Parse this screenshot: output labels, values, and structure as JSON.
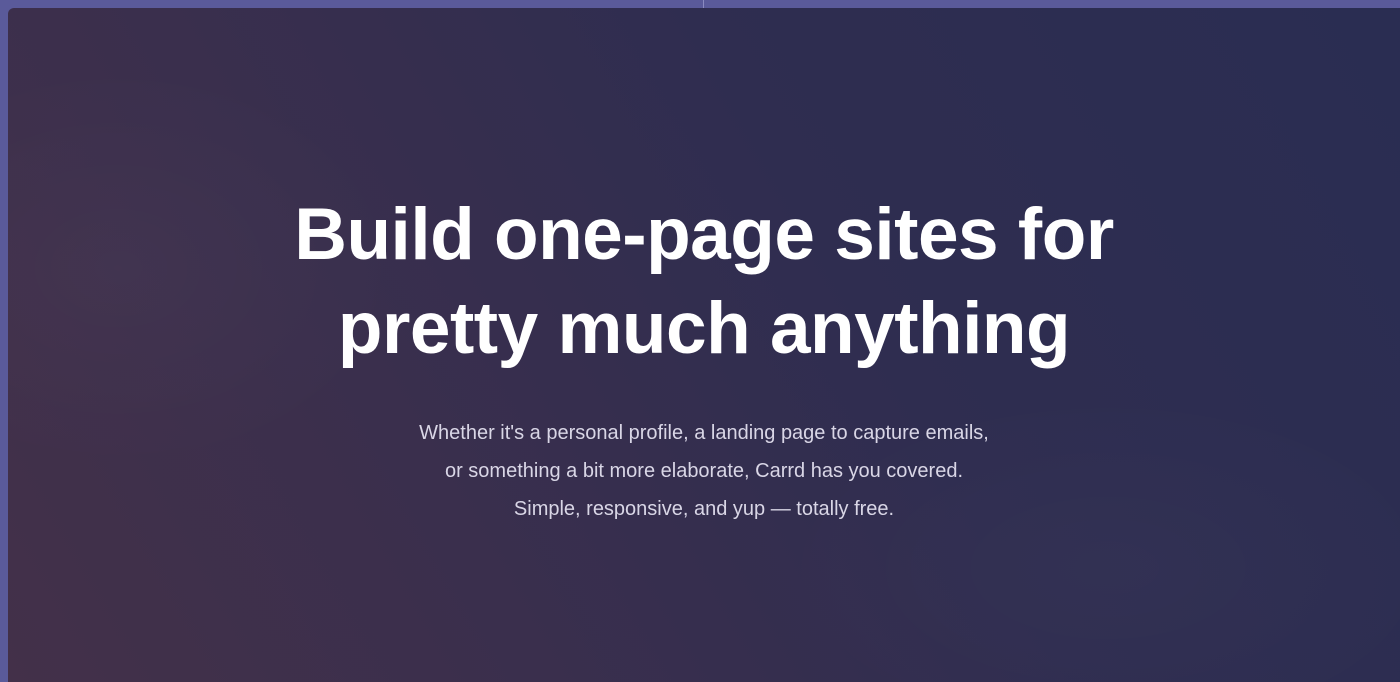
{
  "hero": {
    "title_lines": [
      "Build one-page sites for",
      "pretty much anything"
    ],
    "description_lines": [
      "Whether it's a personal profile, a landing page to capture emails,",
      "or something a bit more elaborate, Carrd has you covered.",
      "Simple, responsive, and yup — totally free."
    ]
  },
  "colors": {
    "frame": "#5a5a9a",
    "gradient_start": "#433049",
    "gradient_end": "#2a2d52",
    "title_text": "#ffffff",
    "description_text": "#d9d6e6"
  }
}
